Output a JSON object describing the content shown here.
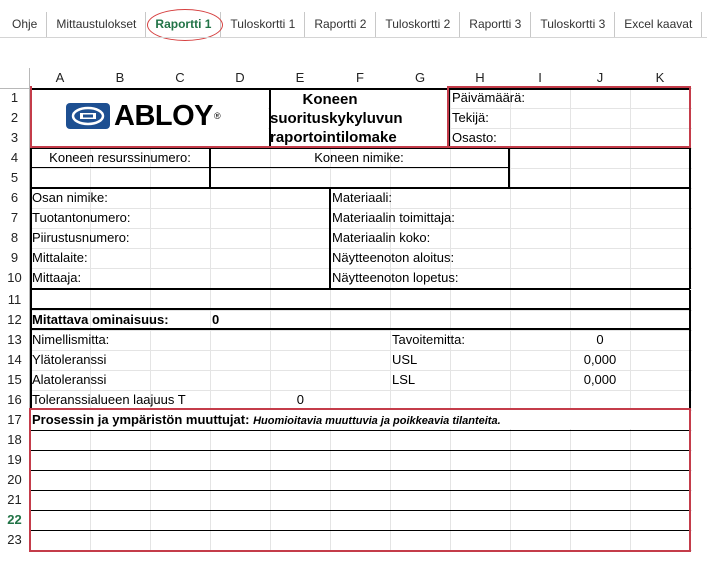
{
  "sheet_tabs": [
    {
      "label": "Ohje"
    },
    {
      "label": "Mittaustulokset"
    },
    {
      "label": "Raportti 1",
      "active": true
    },
    {
      "label": "Tuloskortti 1"
    },
    {
      "label": "Raportti 2"
    },
    {
      "label": "Tuloskortti 2"
    },
    {
      "label": "Raportti 3"
    },
    {
      "label": "Tuloskortti 3"
    },
    {
      "label": "Excel kaavat"
    }
  ],
  "columns": [
    "A",
    "B",
    "C",
    "D",
    "E",
    "F",
    "G",
    "H",
    "I",
    "J",
    "K"
  ],
  "rows": [
    "1",
    "2",
    "3",
    "4",
    "5",
    "6",
    "7",
    "8",
    "9",
    "10",
    "11",
    "12",
    "13",
    "14",
    "15",
    "16",
    "17",
    "18",
    "19",
    "20",
    "21",
    "22",
    "23"
  ],
  "active_row": "22",
  "logo": {
    "text": "ABLOY",
    "reg": "®",
    "mark_color": "#1d4f91"
  },
  "form": {
    "title_line1": "Koneen",
    "title_line2": "suorituskykyluvun",
    "title_line3": "raportointilomake",
    "date_label": "Päivämäärä:",
    "author_label": "Tekijä:",
    "department_label": "Osasto:",
    "machine_resource_label": "Koneen resurssinumero:",
    "machine_name_label": "Koneen nimike:",
    "part_name_label": "Osan nimike:",
    "production_number_label": "Tuotantonumero:",
    "drawing_number_label": "Piirustusnumero:",
    "measuring_device_label": "Mittalaite:",
    "measurer_label": "Mittaaja:",
    "material_label": "Materiaali:",
    "material_supplier_label": "Materiaalin toimittaja:",
    "material_size_label": "Materiaalin koko:",
    "sampling_start_label": "Näytteenoton aloitus:",
    "sampling_end_label": "Näytteenoton lopetus:",
    "measured_property_label": "Mitattava ominaisuus:",
    "measured_property_value": "0",
    "nominal_label": "Nimellismitta:",
    "upper_tol_label": "Ylätoleranssi",
    "lower_tol_label": "Alatoleranssi",
    "tol_range_label": "Toleranssialueen laajuus T",
    "tol_range_value": "0",
    "target_label": "Tavoitemitta:",
    "target_value": "0",
    "usl_label": "USL",
    "usl_value": "0,000",
    "lsl_label": "LSL",
    "lsl_value": "0,000",
    "process_label": "Prosessin ja ympäristön muuttujat:",
    "process_note": "Huomioitavia muuttuvia ja poikkeavia tilanteita."
  },
  "colors": {
    "active_tab": "#217346",
    "highlight_border": "#c43c4a"
  }
}
